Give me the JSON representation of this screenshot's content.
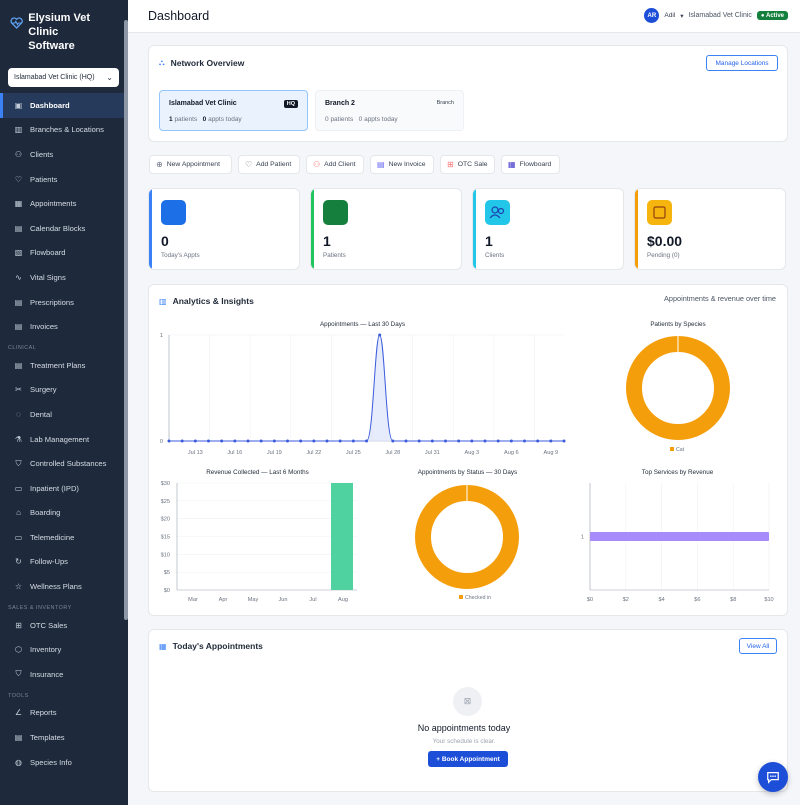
{
  "app": {
    "title_line1": "Elysium Vet Clinic",
    "title_line2": "Software"
  },
  "location_select": {
    "value": "Islamabad Vet Clinic (HQ)"
  },
  "sidebar": {
    "items_main": [
      {
        "label": "Dashboard",
        "icon": "dashboard-icon",
        "active": true
      },
      {
        "label": "Branches & Locations",
        "icon": "building-icon"
      },
      {
        "label": "Clients",
        "icon": "users-icon"
      },
      {
        "label": "Patients",
        "icon": "heart-icon"
      },
      {
        "label": "Appointments",
        "icon": "calendar-icon"
      },
      {
        "label": "Calendar Blocks",
        "icon": "calendar-block-icon"
      },
      {
        "label": "Flowboard",
        "icon": "flowboard-icon"
      },
      {
        "label": "Vital Signs",
        "icon": "pulse-icon"
      },
      {
        "label": "Prescriptions",
        "icon": "prescription-icon"
      },
      {
        "label": "Invoices",
        "icon": "invoice-icon"
      }
    ],
    "section_clinical": "CLINICAL",
    "items_clinical": [
      {
        "label": "Treatment Plans",
        "icon": "clipboard-icon"
      },
      {
        "label": "Surgery",
        "icon": "scissors-icon"
      },
      {
        "label": "Dental",
        "icon": "tooth-icon"
      },
      {
        "label": "Lab Management",
        "icon": "flask-icon"
      },
      {
        "label": "Controlled Substances",
        "icon": "shield-icon"
      },
      {
        "label": "Inpatient (IPD)",
        "icon": "bed-icon"
      },
      {
        "label": "Boarding",
        "icon": "home-icon"
      },
      {
        "label": "Telemedicine",
        "icon": "video-icon"
      },
      {
        "label": "Follow-Ups",
        "icon": "refresh-icon"
      },
      {
        "label": "Wellness Plans",
        "icon": "star-icon"
      }
    ],
    "section_sales": "SALES & INVENTORY",
    "items_sales": [
      {
        "label": "OTC Sales",
        "icon": "cart-icon"
      },
      {
        "label": "Inventory",
        "icon": "box-icon"
      },
      {
        "label": "Insurance",
        "icon": "shield-check-icon"
      }
    ],
    "section_tools": "TOOLS",
    "items_tools": [
      {
        "label": "Reports",
        "icon": "chart-icon"
      },
      {
        "label": "Templates",
        "icon": "template-icon"
      },
      {
        "label": "Species Info",
        "icon": "globe-icon"
      }
    ]
  },
  "header": {
    "title": "Dashboard",
    "avatar": "AR",
    "user": "Adil",
    "clinic": "Islamabad Vet Clinic",
    "status": "Active"
  },
  "network": {
    "title": "Network Overview",
    "manage_label": "Manage Locations",
    "locations": [
      {
        "name": "Islamabad Vet Clinic",
        "tag": "HQ",
        "patients": "1",
        "patients_label": "patients",
        "appts": "0",
        "appts_label": "appts today"
      },
      {
        "name": "Branch 2",
        "tag": "Branch",
        "patients": "0",
        "patients_label": "patients",
        "appts": "0",
        "appts_label": "appts today"
      }
    ]
  },
  "quick_actions": [
    "New Appointment",
    "Add Patient",
    "Add Client",
    "New Invoice",
    "OTC Sale",
    "Flowboard"
  ],
  "stats": [
    {
      "value": "0",
      "label": "Today's Appts",
      "color": "#1d6fe8"
    },
    {
      "value": "1",
      "label": "Patients",
      "color": "#15803d"
    },
    {
      "value": "1",
      "label": "Clients",
      "color": "#22c6e8"
    },
    {
      "value": "$0.00",
      "label": "Pending (0)",
      "color": "#f5b40e"
    }
  ],
  "analytics": {
    "title": "Analytics & Insights",
    "subtitle": "Appointments & revenue over time"
  },
  "chart_data": [
    {
      "type": "line",
      "title": "Appointments — Last 30 Days",
      "x": [
        "Jul 11",
        "Jul 12",
        "Jul 13",
        "Jul 14",
        "Jul 15",
        "Jul 16",
        "Jul 17",
        "Jul 18",
        "Jul 19",
        "Jul 20",
        "Jul 21",
        "Jul 22",
        "Jul 23",
        "Jul 24",
        "Jul 25",
        "Jul 26",
        "Jul 27",
        "Jul 28",
        "Jul 29",
        "Jul 30",
        "Jul 31",
        "Aug 1",
        "Aug 2",
        "Aug 3",
        "Aug 4",
        "Aug 5",
        "Aug 6",
        "Aug 7",
        "Aug 8",
        "Aug 9",
        "Aug 10"
      ],
      "values": [
        0,
        0,
        0,
        0,
        0,
        0,
        0,
        0,
        0,
        0,
        0,
        0,
        0,
        0,
        0,
        0,
        1,
        0,
        0,
        0,
        0,
        0,
        0,
        0,
        0,
        0,
        0,
        0,
        0,
        0,
        0
      ],
      "x_tick_labels": [
        "Jul 13",
        "Jul 16",
        "Jul 19",
        "Jul 22",
        "Jul 25",
        "Jul 28",
        "Jul 31",
        "Aug 3",
        "Aug 6",
        "Aug 9"
      ],
      "y_tick_labels": [
        "0",
        "1"
      ],
      "ylim": [
        0,
        1
      ],
      "color": "#3b5bdb"
    },
    {
      "type": "pie",
      "title": "Patients by Species",
      "labels": [
        "Cat"
      ],
      "values": [
        1
      ],
      "colors": [
        "#f59e0b"
      ],
      "legend": "bottom"
    },
    {
      "type": "bar",
      "title": "Revenue Collected — Last 6 Months",
      "categories": [
        "Mar",
        "Apr",
        "May",
        "Jun",
        "Jul",
        "Aug"
      ],
      "values": [
        0,
        0,
        0,
        0,
        0,
        30
      ],
      "y_tick_labels": [
        "$0",
        "$5",
        "$10",
        "$15",
        "$20",
        "$25",
        "$30"
      ],
      "ylim": [
        0,
        30
      ],
      "color": "#4fd1a0"
    },
    {
      "type": "pie",
      "title": "Appointments by Status — 30 Days",
      "labels": [
        "Checked in"
      ],
      "values": [
        1
      ],
      "colors": [
        "#f59e0b"
      ],
      "legend": "bottom"
    },
    {
      "type": "bar",
      "orientation": "horizontal",
      "title": "Top Services by Revenue",
      "categories": [
        "1"
      ],
      "values": [
        10
      ],
      "x_tick_labels": [
        "$0",
        "$2",
        "$4",
        "$6",
        "$8",
        "$10"
      ],
      "xlim": [
        0,
        10
      ],
      "color": "#a78bfa"
    }
  ],
  "appointments": {
    "title": "Today's Appointments",
    "view_all": "View All",
    "empty_title": "No appointments today",
    "empty_sub": "Your schedule is clear.",
    "book_label": "+ Book Appointment"
  }
}
